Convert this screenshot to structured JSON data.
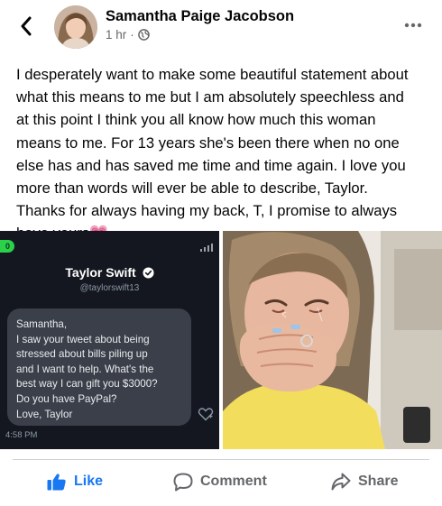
{
  "post": {
    "author": "Samantha Paige Jacobson",
    "time": "1 hr",
    "separator": "·",
    "privacy_icon": "globe-icon",
    "text_lines": [
      "I desperately want to make some beautiful statement about",
      "what this means to me but I am absolutely speechless and",
      "at this point I think you all know how much this woman",
      "means to me. For 13 years she's been there when no one",
      "else has and has saved me time and time again. I love you",
      "more than words will ever be able to describe, Taylor.",
      "Thanks for always having my back, T, I promise to always",
      "have yours"
    ],
    "emoji": "💗"
  },
  "tweet_image": {
    "name": "Taylor Swift",
    "handle": "@taylorswift13",
    "message_lines": [
      "Samantha,",
      "I saw your tweet about being",
      "stressed about bills piling up",
      "and I want to help. What's the",
      "best way I can gift you $3000?",
      "Do you have PayPal?",
      "Love, Taylor"
    ],
    "timestamp": "4:58 PM",
    "status_text": "0"
  },
  "actions": {
    "like": "Like",
    "comment": "Comment",
    "share": "Share"
  },
  "colors": {
    "brand_blue": "#1877f2",
    "secondary_text": "#65676b",
    "dm_background": "#14171f",
    "dm_bubble": "#3a3f49"
  }
}
